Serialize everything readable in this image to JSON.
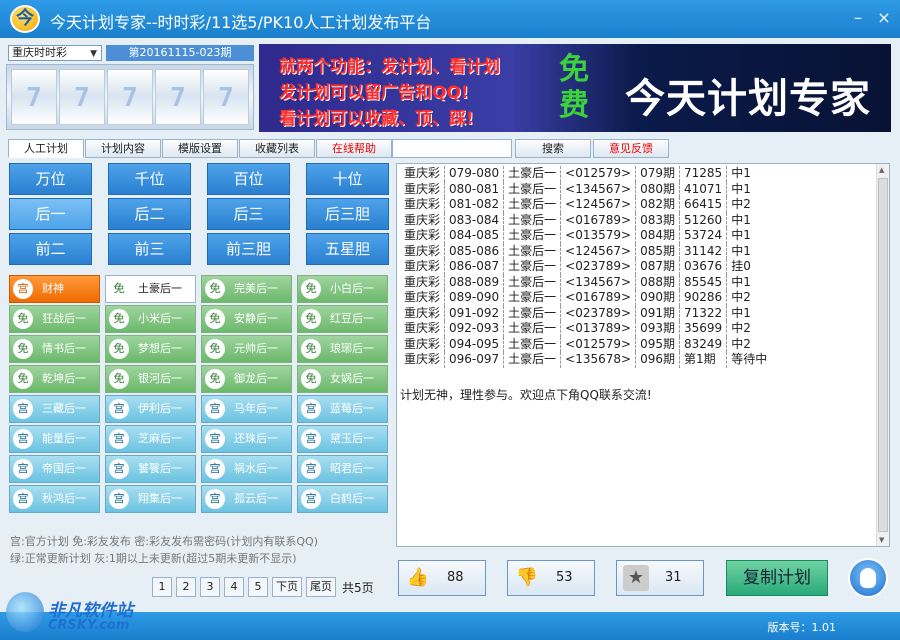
{
  "window": {
    "title": "今天计划专家--时时彩/11选5/PK10人工计划发布平台",
    "logo_char": "今",
    "min_glyph": "–",
    "close_glyph": "×"
  },
  "lottery_select": {
    "value": "重庆时时彩",
    "arrow": "▼"
  },
  "period_label": "第20161115-023期",
  "draw_digits": [
    "7",
    "7",
    "7",
    "7",
    "7"
  ],
  "banner": {
    "line1": "就两个功能：发计划、看计划",
    "line2": "发计划可以留广告和QQ!",
    "line3": "看计划可以收藏、顶、踩!",
    "free": "免费",
    "brand": "今天计划专家"
  },
  "tabs": [
    {
      "label": "人工计划",
      "active": true,
      "red": false
    },
    {
      "label": "计划内容",
      "active": false,
      "red": false
    },
    {
      "label": "模版设置",
      "active": false,
      "red": false
    },
    {
      "label": "收藏列表",
      "active": false,
      "red": false
    },
    {
      "label": "在线帮助",
      "active": false,
      "red": true
    }
  ],
  "search_button": "搜索",
  "feedback_button": "意见反馈",
  "position_buttons": [
    "万位",
    "千位",
    "百位",
    "十位",
    "后一",
    "后二",
    "后三",
    "后三胆",
    "前二",
    "前三",
    "前三胆",
    "五星胆"
  ],
  "plans": [
    {
      "icon": "宫",
      "label": "财神",
      "style": "orange"
    },
    {
      "icon": "免",
      "label": "土豪后一",
      "style": "white"
    },
    {
      "icon": "免",
      "label": "完美后一",
      "style": "green"
    },
    {
      "icon": "免",
      "label": "小白后一",
      "style": "green"
    },
    {
      "icon": "免",
      "label": "狂战后一",
      "style": "green"
    },
    {
      "icon": "免",
      "label": "小米后一",
      "style": "green"
    },
    {
      "icon": "免",
      "label": "安静后一",
      "style": "green"
    },
    {
      "icon": "免",
      "label": "红豆后一",
      "style": "green"
    },
    {
      "icon": "免",
      "label": "情书后一",
      "style": "green"
    },
    {
      "icon": "免",
      "label": "梦想后一",
      "style": "green"
    },
    {
      "icon": "免",
      "label": "元帅后一",
      "style": "green"
    },
    {
      "icon": "免",
      "label": "琅琊后一",
      "style": "green"
    },
    {
      "icon": "免",
      "label": "乾坤后一",
      "style": "green"
    },
    {
      "icon": "免",
      "label": "银河后一",
      "style": "green"
    },
    {
      "icon": "免",
      "label": "御龙后一",
      "style": "green"
    },
    {
      "icon": "免",
      "label": "女娲后一",
      "style": "green"
    },
    {
      "icon": "宫",
      "label": "三藏后一",
      "style": "cyan"
    },
    {
      "icon": "宫",
      "label": "伊利后一",
      "style": "cyan"
    },
    {
      "icon": "宫",
      "label": "马年后一",
      "style": "cyan"
    },
    {
      "icon": "宫",
      "label": "蓝莓后一",
      "style": "cyan"
    },
    {
      "icon": "宫",
      "label": "能量后一",
      "style": "cyan"
    },
    {
      "icon": "宫",
      "label": "芝麻后一",
      "style": "cyan"
    },
    {
      "icon": "宫",
      "label": "还珠后一",
      "style": "cyan"
    },
    {
      "icon": "宫",
      "label": "黛玉后一",
      "style": "cyan"
    },
    {
      "icon": "宫",
      "label": "帝国后一",
      "style": "cyan"
    },
    {
      "icon": "宫",
      "label": "饕餮后一",
      "style": "cyan"
    },
    {
      "icon": "宫",
      "label": "祸水后一",
      "style": "cyan"
    },
    {
      "icon": "宫",
      "label": "昭君后一",
      "style": "cyan"
    },
    {
      "icon": "宫",
      "label": "秋鸿后一",
      "style": "cyan"
    },
    {
      "icon": "宫",
      "label": "翔集后一",
      "style": "cyan"
    },
    {
      "icon": "宫",
      "label": "孤云后一",
      "style": "cyan"
    },
    {
      "icon": "宫",
      "label": "白鹤后一",
      "style": "cyan"
    }
  ],
  "legend": {
    "line1": "宫:官方计划   免:彩友发布   密:彩友发布需密码(计划内有联系QQ)",
    "line2": "绿:正常更新计划   灰:1期以上未更新(超过5期未更新不显示)"
  },
  "pager": {
    "pages": [
      "1",
      "2",
      "3",
      "4",
      "5"
    ],
    "next": "下页",
    "last": "尾页",
    "total": "共5页"
  },
  "records": [
    [
      "重庆彩",
      "079-080",
      "土豪后一",
      "<012579>",
      "079期",
      "71285",
      "中1"
    ],
    [
      "重庆彩",
      "080-081",
      "土豪后一",
      "<134567>",
      "080期",
      "41071",
      "中1"
    ],
    [
      "重庆彩",
      "081-082",
      "土豪后一",
      "<124567>",
      "082期",
      "66415",
      "中2"
    ],
    [
      "重庆彩",
      "083-084",
      "土豪后一",
      "<016789>",
      "083期",
      "51260",
      "中1"
    ],
    [
      "重庆彩",
      "084-085",
      "土豪后一",
      "<013579>",
      "084期",
      "53724",
      "中1"
    ],
    [
      "重庆彩",
      "085-086",
      "土豪后一",
      "<124567>",
      "085期",
      "31142",
      "中1"
    ],
    [
      "重庆彩",
      "086-087",
      "土豪后一",
      "<023789>",
      "087期",
      "03676",
      "挂0"
    ],
    [
      "重庆彩",
      "088-089",
      "土豪后一",
      "<134567>",
      "088期",
      "85545",
      "中1"
    ],
    [
      "重庆彩",
      "089-090",
      "土豪后一",
      "<016789>",
      "090期",
      "90286",
      "中2"
    ],
    [
      "重庆彩",
      "091-092",
      "土豪后一",
      "<023789>",
      "091期",
      "71322",
      "中1"
    ],
    [
      "重庆彩",
      "092-093",
      "土豪后一",
      "<013789>",
      "093期",
      "35699",
      "中2"
    ],
    [
      "重庆彩",
      "094-095",
      "土豪后一",
      "<012579>",
      "095期",
      "83249",
      "中2"
    ],
    [
      "重庆彩",
      "096-097",
      "土豪后一",
      "<135678>",
      "096期",
      "第1期",
      "等待中"
    ]
  ],
  "note": "计划无神，理性参与。欢迎点下角QQ联系交流!",
  "feedback": {
    "up": "88",
    "down": "53",
    "fav": "31",
    "up_icon": "👍",
    "down_icon": "👎",
    "fav_icon": "★"
  },
  "copy_button": "复制计划",
  "version": "版本号：1.01",
  "watermark": {
    "line1": "非凡软件站",
    "line2": "CRSKY.com"
  }
}
